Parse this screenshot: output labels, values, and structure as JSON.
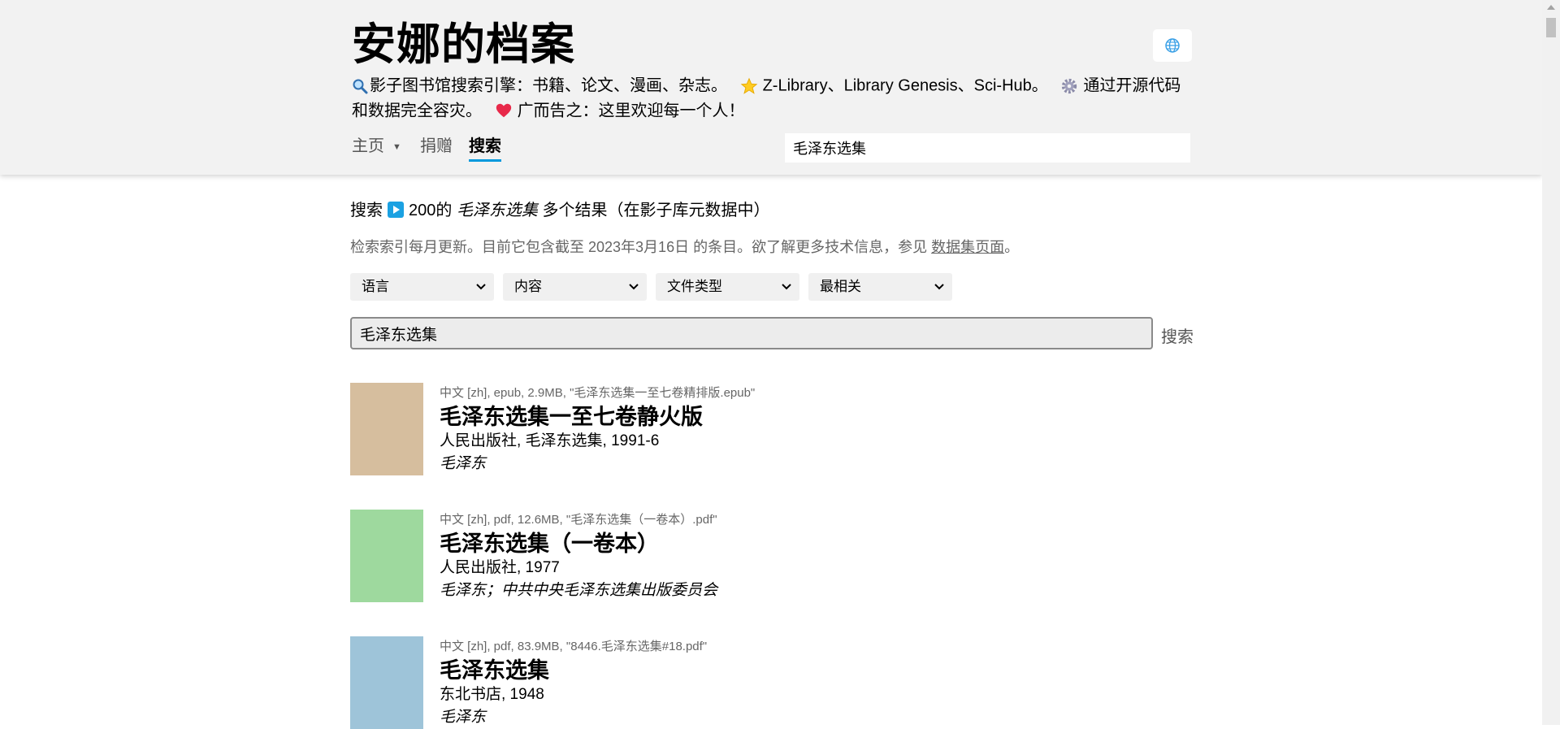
{
  "header": {
    "title": "安娜的档案",
    "tagline": {
      "part1": "影子图书馆搜索引擎：书籍、论文、漫画、杂志。",
      "part2": "Z-Library、Library Genesis、Sci-Hub。",
      "part3": "通过开源代码和数据完全容灾。",
      "part4": "广而告之：这里欢迎每一个人！"
    },
    "nav": {
      "home": "主页",
      "donate": "捐赠",
      "search": "搜索"
    },
    "search_value": "毛泽东选集"
  },
  "main": {
    "summary": {
      "prefix": "搜索",
      "count": "200的",
      "query": "毛泽东选集",
      "suffix": "多个结果（在影子库元数据中）"
    },
    "notice": {
      "text": "检索索引每月更新。目前它包含截至 2023年3月16日 的条目。欲了解更多技术信息，参见",
      "link": "数据集页面",
      "end": "。"
    },
    "filters": {
      "language": "语言",
      "content": "内容",
      "filetype": "文件类型",
      "sort": "最相关"
    },
    "search": {
      "value": "毛泽东选集",
      "button": "搜索"
    },
    "results": [
      {
        "meta": "中文 [zh], epub, 2.9MB, \"毛泽东选集一至七卷精排版.epub\"",
        "title": "毛泽东选集一至七卷静火版",
        "publisher": "人民出版社, 毛泽东选集, 1991-6",
        "author": "毛泽东",
        "cover_color": "#d6be9e"
      },
      {
        "meta": "中文 [zh], pdf, 12.6MB, \"毛泽东选集（一卷本）.pdf\"",
        "title": "毛泽东选集（一卷本）",
        "publisher": "人民出版社, 1977",
        "author": "毛泽东；中共中央毛泽东选集出版委员会",
        "cover_color": "#9ed99e"
      },
      {
        "meta": "中文 [zh], pdf, 83.9MB, \"8446.毛泽东选集#18.pdf\"",
        "title": "毛泽东选集",
        "publisher": "东北书店, 1948",
        "author": "毛泽东",
        "cover_color": "#9ec4d9"
      }
    ]
  },
  "colors": {
    "header_bg": "#f2f2f2",
    "accent": "#0099dd",
    "play_icon": "#1ba1e2"
  },
  "icons": {
    "lang": "globe-icon",
    "tag1": "magnifier-icon",
    "tag2": "star-icon",
    "tag3": "gear-icon",
    "tag4": "heart-icon"
  }
}
